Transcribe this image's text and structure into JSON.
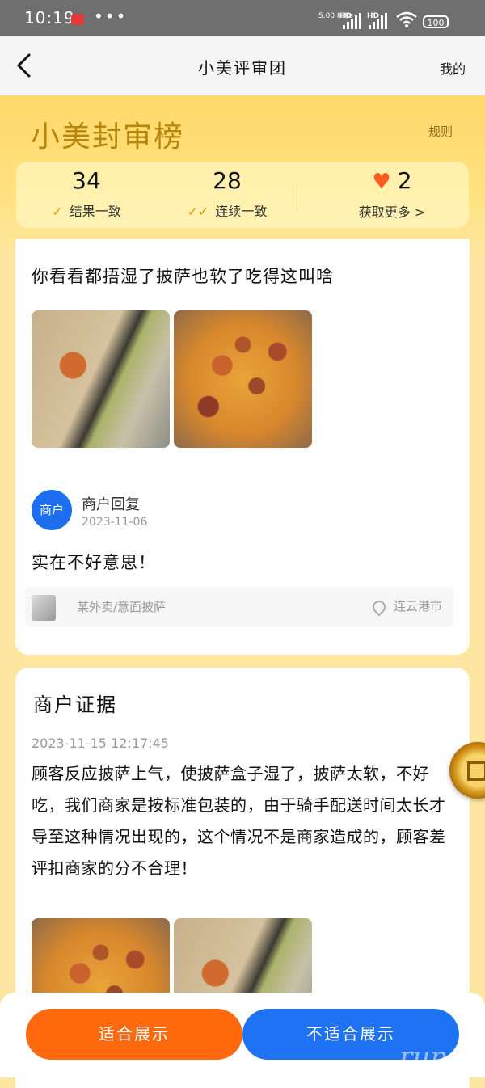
{
  "status_bar": {
    "time": "10:19",
    "dots": "•••",
    "net_speed": "5.00 KB/s",
    "hd1": "HD",
    "hd2": "HD",
    "battery": "100"
  },
  "nav": {
    "title": "小美评审团",
    "right_link": "我的"
  },
  "hero": {
    "brand": "小美封审榜",
    "rules_link": "规则"
  },
  "stats": [
    {
      "value": "34",
      "label": "结果一致"
    },
    {
      "value": "28",
      "label": "连续一致"
    },
    {
      "value": "2",
      "label": "获取更多 >"
    }
  ],
  "review": {
    "text": "你看看都捂湿了披萨也软了吃得这叫啥",
    "merchant_reply": {
      "avatar_text": "商户",
      "title": "商户回复",
      "date": "2023-11-06",
      "text": "实在不好意思！"
    },
    "store_info": {
      "store": "某外卖/意面披萨",
      "location": "连云港市"
    }
  },
  "evidence": {
    "heading": "商户证据",
    "timestamp": "2023-11-15 12:17:45",
    "body": "顾客反应披萨上气，使披萨盒子湿了，披萨太软，不好吃，我们商家是按标准包装的，由于骑手配送时间太长才导至这种情况出现的，这个情况不是商家造成的，顾客差评扣商家的分不合理！"
  },
  "footer": {
    "approve": "适合展示",
    "reject": "不适合展示"
  },
  "watermark": "run",
  "colors": {
    "approve_bg": "#ff6a0f",
    "reject_bg": "#1e73f2",
    "brand": "#b8860b",
    "avatar": "#1e6ff0"
  }
}
